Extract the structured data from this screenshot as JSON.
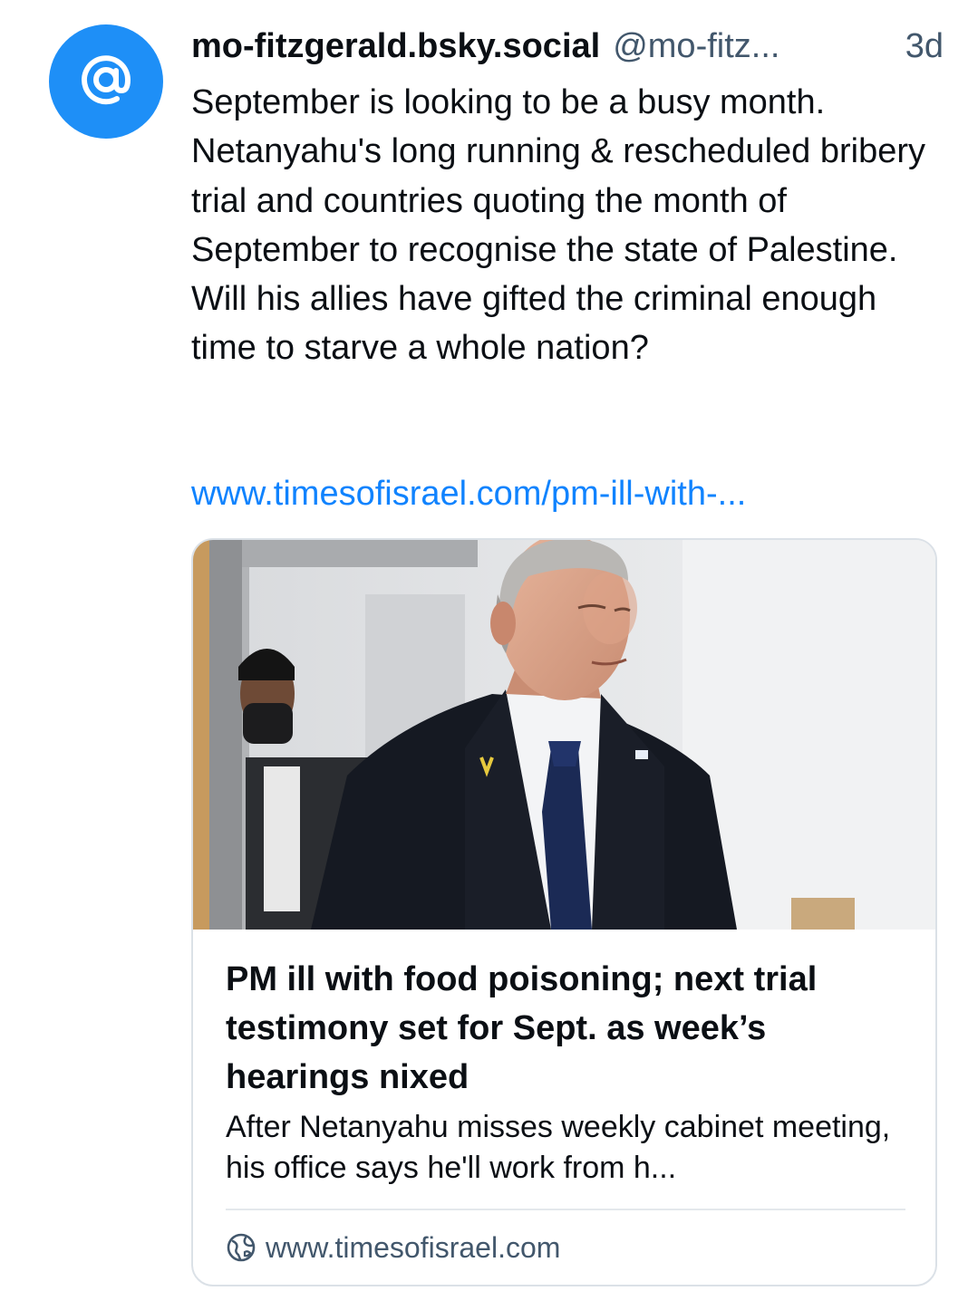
{
  "post": {
    "display_name": "mo-fitzgerald.bsky.social",
    "handle": "@mo-fitz...",
    "timestamp": "3d",
    "text": "September is looking to be a busy month.\nNetanyahu's long running & rescheduled bribery trial and countries quoting the month of September to recognise the state of Palestine.\nWill his allies have gifted the  criminal enough time to starve a whole nation?",
    "link_text": "www.timesofisrael.com/pm-ill-with-...",
    "avatar_icon": "at-sign-icon"
  },
  "card": {
    "title": "PM ill with food poisoning; next trial testimony set for Sept. as week’s hearings nixed",
    "description": "After Netanyahu misses weekly cabinet meeting, his office says he'll work from h...",
    "domain": "www.timesofisrael.com",
    "domain_icon": "globe-icon"
  },
  "colors": {
    "avatar_bg": "#1e8ff7",
    "link": "#1083fe",
    "muted": "#42576c",
    "border": "#dbe1e7"
  }
}
